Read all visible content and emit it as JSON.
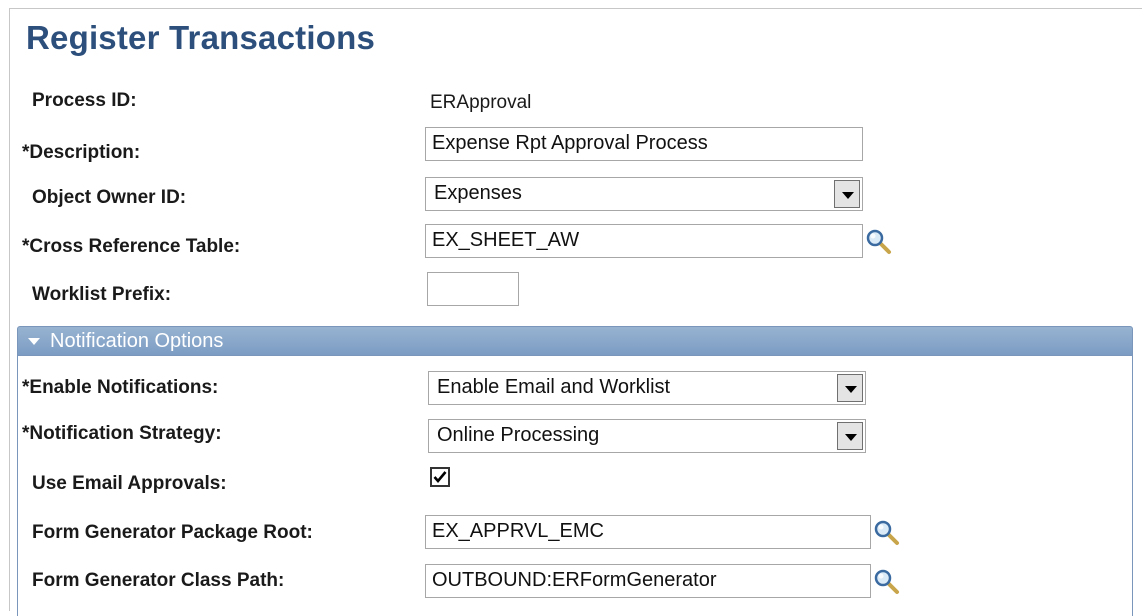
{
  "page": {
    "title": "Register Transactions"
  },
  "fields": {
    "process_id": {
      "label": "Process ID:",
      "value": "ERApproval"
    },
    "description": {
      "label": "*Description:",
      "value": "Expense Rpt Approval Process"
    },
    "object_owner_id": {
      "label": "Object Owner ID:",
      "value": "Expenses"
    },
    "cross_reference_table": {
      "label": "*Cross Reference Table:",
      "value": "EX_SHEET_AW"
    },
    "worklist_prefix": {
      "label": "Worklist Prefix:",
      "value": ""
    }
  },
  "notification_section": {
    "title": "Notification Options",
    "enable_notifications": {
      "label": "*Enable Notifications:",
      "value": "Enable Email and Worklist"
    },
    "notification_strategy": {
      "label": "*Notification Strategy:",
      "value": "Online Processing"
    },
    "use_email_approvals": {
      "label": "Use Email Approvals:",
      "checked": true
    },
    "form_generator_package_root": {
      "label": "Form Generator Package Root:",
      "value": "EX_APPRVL_EMC"
    },
    "form_generator_class_path": {
      "label": "Form Generator Class Path:",
      "value": "OUTBOUND:ERFormGenerator"
    }
  },
  "icons": {
    "lookup": "magnifier-lookup-icon",
    "dropdown": "chevron-down-icon",
    "collapse": "triangle-down-icon",
    "checkmark": "checkmark-icon"
  },
  "colors": {
    "title": "#2c4f7c",
    "section_header": "#8aa8cb",
    "section_title_text": "#ffffff"
  }
}
